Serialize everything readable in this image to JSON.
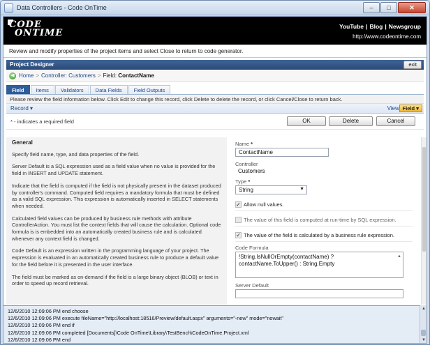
{
  "window": {
    "title": "Data Controllers - Code OnTime",
    "controls": [
      "–",
      "□",
      "✕"
    ]
  },
  "header": {
    "logo_line1": "CODE",
    "logo_line2": "ONTIME",
    "links": [
      "YouTube",
      "Blog",
      "Newsgroup"
    ],
    "link_sep": "|",
    "url": "http://www.codeontime.com"
  },
  "intro": "Review and modify properties of the project items and select Close to return to code generator.",
  "designer": {
    "title": "Project Designer",
    "exit_label": "exit"
  },
  "breadcrumb": {
    "home": "Home",
    "sep": ">",
    "controller": "Controller: Customers",
    "field_prefix": "Field:",
    "field_name": "ContactName"
  },
  "tabs": [
    "Field",
    "Items",
    "Validators",
    "Data Fields",
    "Field Outputs"
  ],
  "description": "Please review the field information below. Click Edit to change this record, click Delete to delete the record, or click Cancel/Close to return back.",
  "record_menu": "Record",
  "view": {
    "label": "View:",
    "value": "Field"
  },
  "required_note": "* - indicates a required field",
  "buttons": {
    "ok": "OK",
    "delete": "Delete",
    "cancel": "Cancel"
  },
  "help": {
    "heading": "General",
    "paragraphs": [
      "Specify field name, type, and data properties of the field.",
      "Server Default is a SQL expression used as a field value when no value is provided for the field in INSERT and UPDATE statement.",
      "Indicate that the field is computed if the field is not physically present in the dataset produced by controller's command. Computed field requires a mandatory formula that must be defined as a valid SQL expression. This expression is automatically inserted in SELECT statements when needed.",
      "Calculated field values can be produced by business rule methods with attribute ControllerAction. You must list the context fields that will cause the calculation. Optional code formula is is embedded into an automatically created business rule and is calculated whenever any context field is changed.",
      "Code Default is an expression written in the programming language of your project. The expression is evaluated in an automatically created business rule to produce a default value for the field before it is presented in the user interface.",
      "The field must be marked as on-demand if the field is a large binary object (BLOB) or text in order to speed up record retrieval."
    ]
  },
  "form": {
    "name_label": "Name",
    "required_mark": "*",
    "name_value": "ContactName",
    "controller_label": "Controller",
    "controller_value": "Customers",
    "type_label": "Type",
    "type_value": "String",
    "allow_null_label": "Allow null values.",
    "computed_label": "The value of this field is computed at run-time by SQL expression.",
    "calculated_label": "The value of the field is calculated by a business rule expression.",
    "code_formula_label": "Code Formula",
    "code_formula_line1": "!String.IsNullOrEmpty(contactName) ?",
    "code_formula_line2": "contactName.ToUpper() : String.Empty",
    "server_default_label": "Server Default"
  },
  "log": [
    "12/6/2010 12:09:06 PM end choose",
    "12/6/2010 12:09:06 PM execute fileName=\"http://localhost:18516/Preview/default.aspx\" arguments=\"-new\" mode=\"nowait\"",
    "12/6/2010 12:09:06 PM end if",
    "12/6/2010 12:09:06 PM completed [Documents]\\Code OnTime\\Library\\TestBench\\CodeOnTime.Project.xml",
    "12/6/2010 12:09:06 PM end"
  ]
}
